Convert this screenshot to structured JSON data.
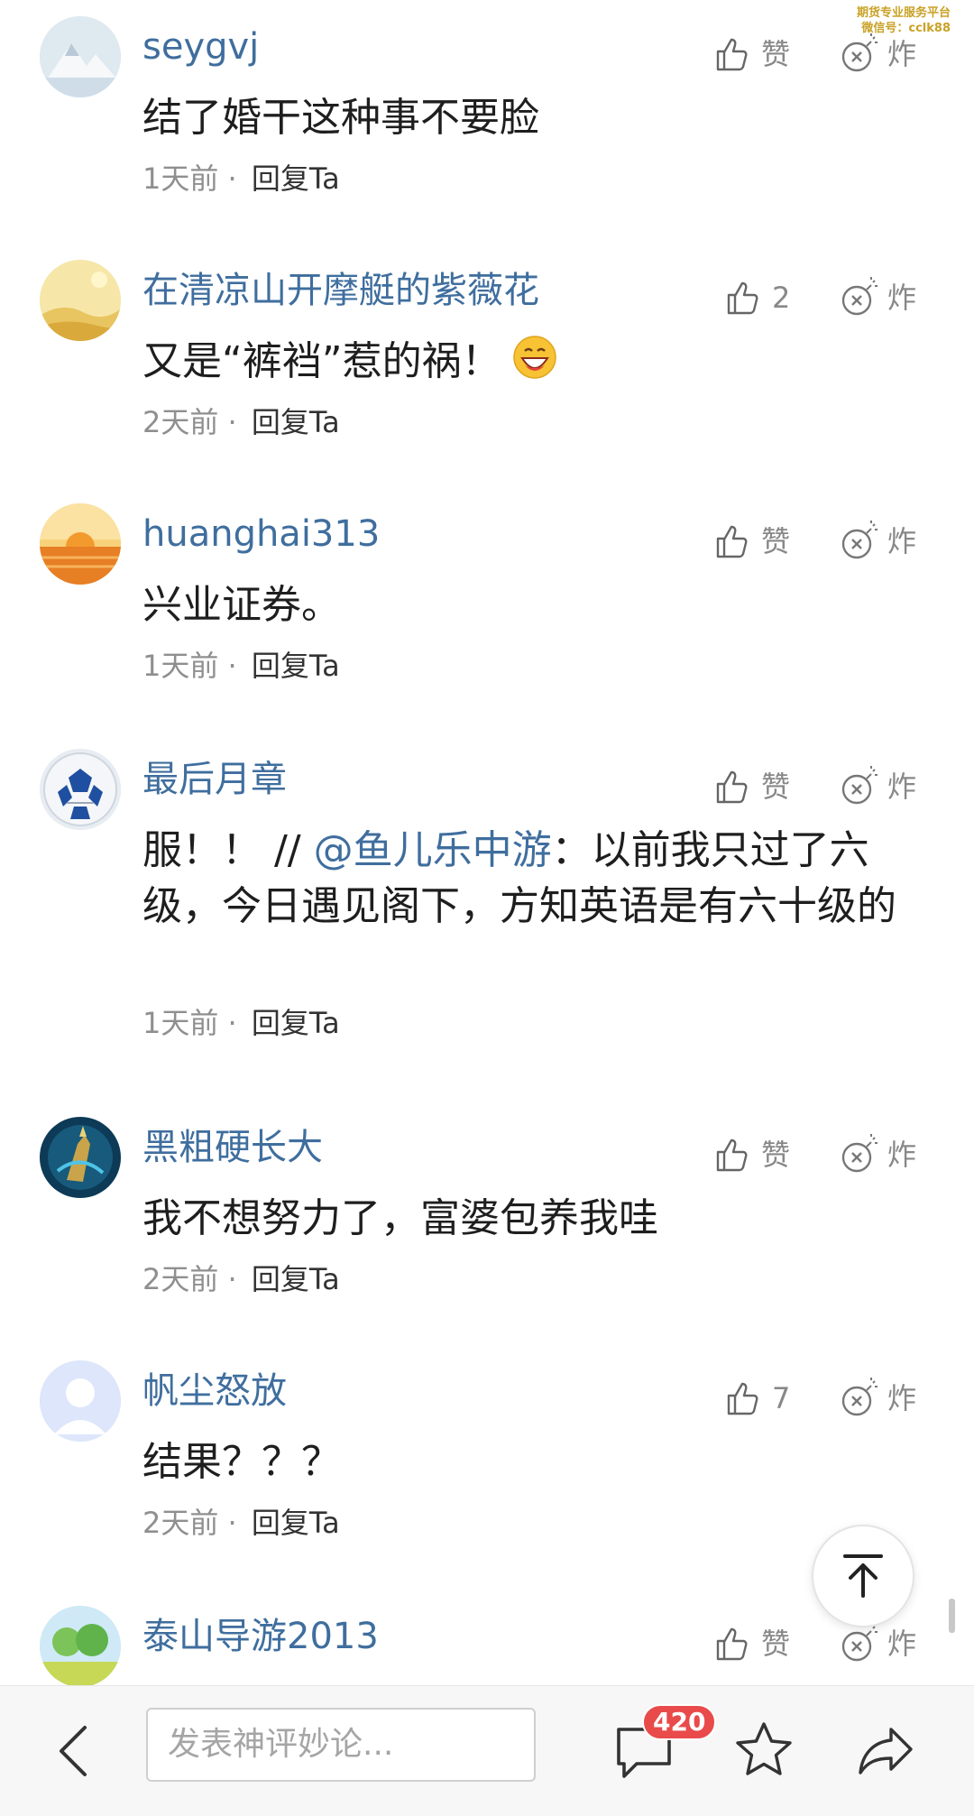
{
  "watermark": {
    "line1": "期货专业服务平台",
    "line2": "微信号：cclk88"
  },
  "comments": [
    {
      "avatar": "snow-mountain-avatar",
      "username": "seygvj",
      "text": "结了婚干这种事不要脸",
      "time": "1天前",
      "sep": "·",
      "reply": "回复Ta",
      "likes": "赞",
      "zha": "炸"
    },
    {
      "avatar": "desert-avatar",
      "username": "在清凉山开摩艇的紫薇花",
      "text": "又是“裤裆”惹的祸！",
      "emoji": "grinning-face-emoji",
      "time": "2天前",
      "sep": "·",
      "reply": "回复Ta",
      "likes": "2",
      "zha": "炸"
    },
    {
      "avatar": "sunset-avatar",
      "username": "huanghai313",
      "text": "兴业证券。",
      "time": "1天前",
      "sep": "·",
      "reply": "回复Ta",
      "likes": "赞",
      "zha": "炸"
    },
    {
      "avatar": "football-avatar",
      "username": "最后月章",
      "text_prefix": "服！！ //",
      "mention": "@鱼儿乐中游",
      "text_suffix": "：以前我只过了六级，今日遇见阁下，方知英语是有六十级的",
      "time": "1天前",
      "sep": "·",
      "reply": "回复Ta",
      "likes": "赞",
      "zha": "炸"
    },
    {
      "avatar": "game-hero-avatar",
      "username": "黑粗硬长大",
      "text": "我不想努力了，富婆包养我哇",
      "time": "2天前",
      "sep": "·",
      "reply": "回复Ta",
      "likes": "赞",
      "zha": "炸"
    },
    {
      "avatar": "default-user-avatar",
      "username": "帆尘怒放",
      "text": "结果？？？",
      "time": "2天前",
      "sep": "·",
      "reply": "回复Ta",
      "likes": "7",
      "zha": "炸"
    },
    {
      "avatar": "tree-avatar",
      "username": "泰山导游2013",
      "likes": "赞",
      "zha": "炸"
    }
  ],
  "bottom_bar": {
    "input_placeholder": "发表神评妙论...",
    "comment_count": "420"
  },
  "colors": {
    "username": "#3f6e9e",
    "badge": "#e94a4a",
    "watermark": "#c9a227"
  },
  "icons": {
    "like": "thumbs-up-icon",
    "zha": "bomb-icon",
    "scroll_top": "arrow-up-to-top-icon",
    "back": "chevron-left-icon",
    "comments": "comment-bubble-icon",
    "favorite": "star-icon",
    "share": "share-arrow-icon"
  }
}
